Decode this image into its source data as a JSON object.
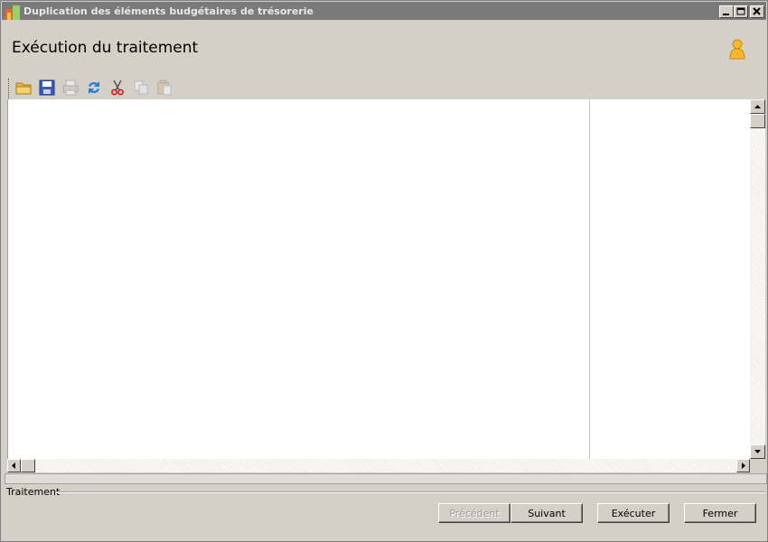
{
  "window": {
    "title": "Duplication des éléments budgétaires de trésorerie",
    "controls": [
      "minimize-icon",
      "maximize-icon",
      "close-icon"
    ]
  },
  "header": {
    "title": "Exécution du traitement",
    "icon": "user-icon"
  },
  "toolbar": {
    "items": [
      {
        "name": "open-folder-icon"
      },
      {
        "name": "save-icon"
      },
      {
        "name": "print-icon",
        "disabled": true
      },
      {
        "name": "refresh-icon"
      },
      {
        "name": "cut-icon"
      },
      {
        "name": "copy-icon",
        "disabled": true
      },
      {
        "name": "paste-icon",
        "disabled": true
      }
    ]
  },
  "section": {
    "label": "Traitement"
  },
  "buttons": {
    "previous": "Précédent",
    "next": "Suivant",
    "execute": "Exécuter",
    "close": "Fermer"
  }
}
